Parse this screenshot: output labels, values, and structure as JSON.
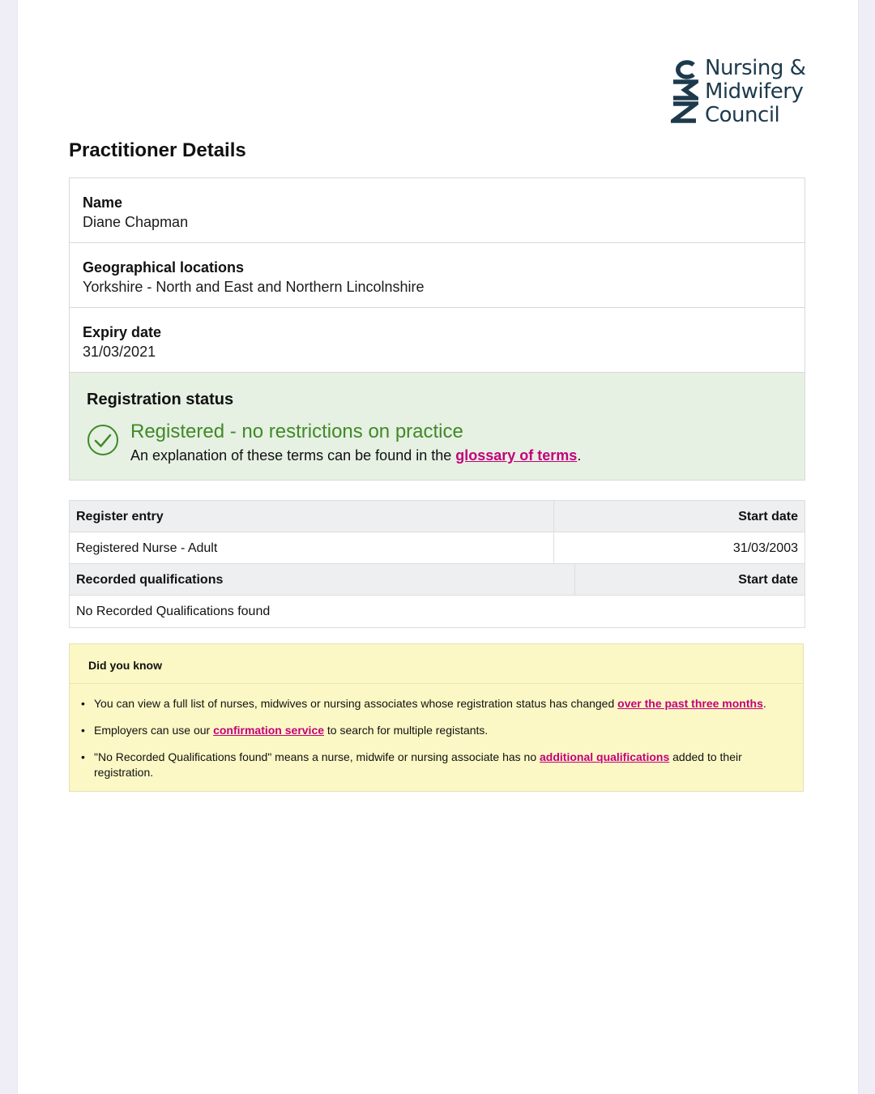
{
  "logo": {
    "mark": "NMC",
    "lines": [
      "Nursing &",
      "Midwifery",
      "Council"
    ]
  },
  "page_title": "Practitioner Details",
  "details": {
    "name_label": "Name",
    "name_value": "Diane Chapman",
    "geo_label": "Geographical locations",
    "geo_value": "Yorkshire - North and East and Northern Lincolnshire",
    "expiry_label": "Expiry date",
    "expiry_value": "31/03/2021"
  },
  "status": {
    "title": "Registration status",
    "main": "Registered - no restrictions on practice",
    "note_prefix": "An explanation of these terms can be found in the ",
    "note_link": "glossary of terms",
    "note_suffix": ".",
    "icon": "check-circle-icon",
    "color": "#3f8a26"
  },
  "register": {
    "header_entry": "Register entry",
    "header_start": "Start date",
    "rows": [
      {
        "entry": "Registered Nurse - Adult",
        "start": "31/03/2003"
      }
    ],
    "qual_header": "Recorded qualifications",
    "qual_start": "Start date",
    "qual_row": "No Recorded Qualifications found"
  },
  "did_you_know": {
    "title": "Did you know",
    "items": [
      {
        "prefix": "You can view a full list of nurses, midwives or nursing associates whose registration status has changed ",
        "link": "over the past three months",
        "suffix": "."
      },
      {
        "prefix": "Employers can use our ",
        "link": "confirmation service",
        "suffix": " to search for multiple registants."
      },
      {
        "prefix": "\"No Recorded Qualifications found\" means a nurse, midwife or nursing associate has no ",
        "link": "additional qualifications",
        "suffix": " added to their registration."
      }
    ]
  },
  "colors": {
    "link": "#c4007a",
    "status_bg": "#e6f0e3",
    "notice_bg": "#fbf8c5",
    "brand": "#1d3a4d"
  }
}
